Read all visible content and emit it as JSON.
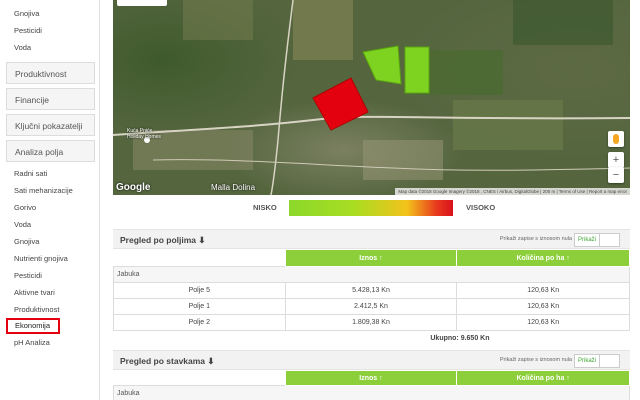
{
  "sidebar": {
    "top_items": [
      {
        "label": "Gnojiva"
      },
      {
        "label": "Pesticidi"
      },
      {
        "label": "Voda"
      }
    ],
    "sections": [
      {
        "label": "Produktivnost"
      },
      {
        "label": "Financije"
      },
      {
        "label": "Ključni pokazatelji"
      },
      {
        "label": "Analiza polja"
      }
    ],
    "sub_items": [
      {
        "label": "Radni sati"
      },
      {
        "label": "Sati mehanizacije"
      },
      {
        "label": "Gorivo"
      },
      {
        "label": "Voda"
      },
      {
        "label": "Gnojiva"
      },
      {
        "label": "Nutrienti gnojiva"
      },
      {
        "label": "Pesticidi"
      },
      {
        "label": "Aktivne tvari"
      },
      {
        "label": "Produktivnost"
      },
      {
        "label": "Ekonomija"
      },
      {
        "label": "pH Analiza"
      }
    ]
  },
  "map": {
    "google_label": "Google",
    "attribution": "Map data ©2018 Google Imagery ©2018 , CNES / Airbus, DigitalGlobe | 200 m  | Terms of Use | Report a map error",
    "place_labels": [
      "Malla Dolina",
      "Kuća Pniće Holiday Homes"
    ],
    "zoom_in": "+",
    "zoom_out": "−",
    "field_colors": {
      "polje5": "#e3000f",
      "polje1": "#7ed321",
      "polje2": "#7ed321"
    }
  },
  "legend": {
    "low": "NISKO",
    "high": "VISOKO"
  },
  "panel_fields": {
    "title": "Pregled po poljima ⬇",
    "toggle_label": "Prikaži zapise s iznosom nula",
    "toggle_value": "Prikaži",
    "col_amount": "Iznos ↑",
    "col_per_ha": "Količina po ha ↑",
    "group": "Jabuka",
    "rows": [
      {
        "name": "Polje 5",
        "amount": "5.428,13 Kn",
        "per_ha": "120,63 Kn"
      },
      {
        "name": "Polje 1",
        "amount": "2.412,5 Kn",
        "per_ha": "120,63 Kn"
      },
      {
        "name": "Polje 2",
        "amount": "1.809,38 Kn",
        "per_ha": "120,63 Kn"
      }
    ],
    "total": "Ukupno: 9.650 Kn"
  },
  "panel_items": {
    "title": "Pregled po stavkama ⬇",
    "toggle_label": "Prikaži zapise s iznosom nula",
    "toggle_value": "Prikaži",
    "col_amount": "Iznos ↑",
    "col_per_ha": "Količina po ha ↑",
    "group": "Jabuka"
  }
}
